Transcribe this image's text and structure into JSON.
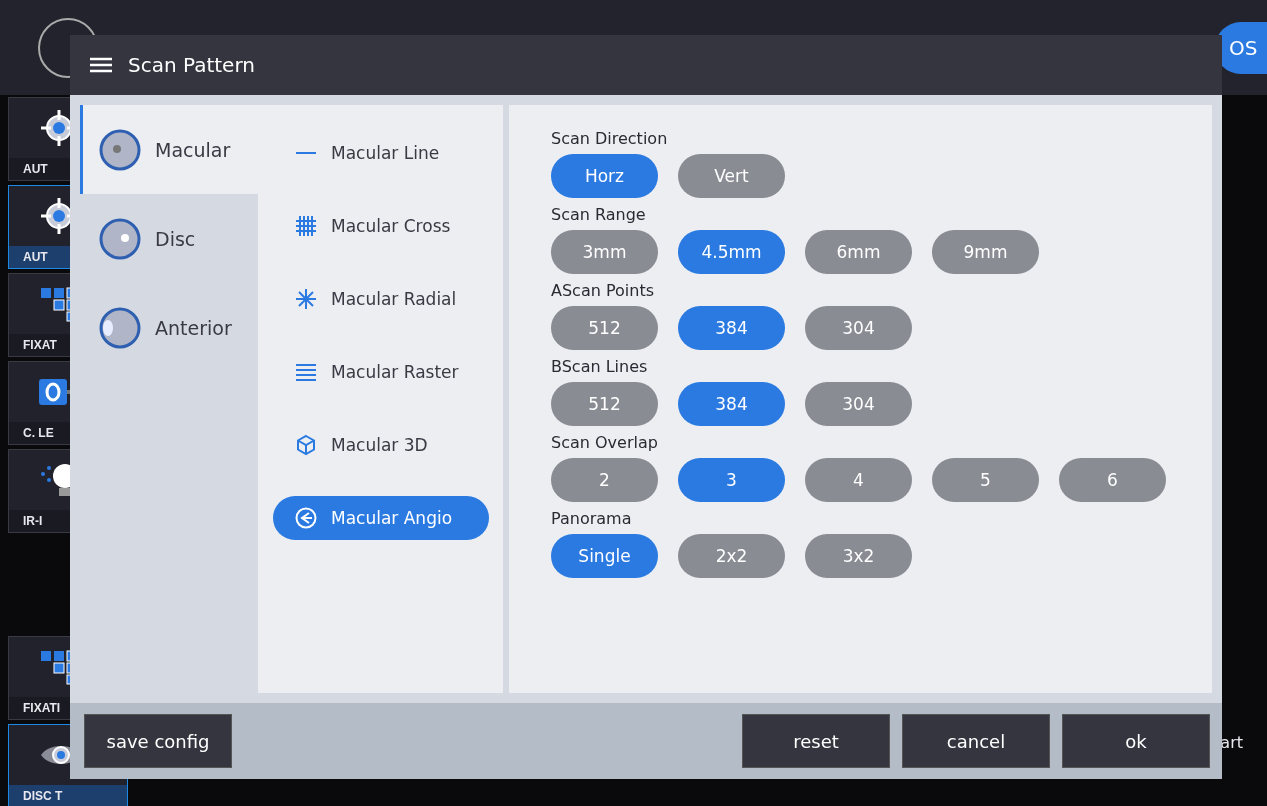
{
  "background": {
    "tiles": [
      {
        "label": "AUT",
        "kind": "target",
        "selected": false
      },
      {
        "label": "AUT",
        "kind": "target",
        "selected": true
      },
      {
        "label": "FIXAT",
        "kind": "grid",
        "selected": false
      },
      {
        "label": "C. LE",
        "kind": "lens",
        "selected": false
      },
      {
        "label": "IR-I",
        "kind": "bulb",
        "selected": false
      }
    ],
    "lower_tiles": [
      {
        "label": "FIXATI",
        "kind": "grid",
        "selected": false
      },
      {
        "label": "DISC T",
        "kind": "eye",
        "selected": true
      }
    ],
    "eye_badge": "OS",
    "side_label": "art"
  },
  "dialog": {
    "title": "Scan Pattern",
    "categories": [
      {
        "label": "Macular",
        "kind": "macular",
        "selected": true
      },
      {
        "label": "Disc",
        "kind": "disc",
        "selected": false
      },
      {
        "label": "Anterior",
        "kind": "anterior",
        "selected": false
      }
    ],
    "patterns": [
      {
        "label": "Macular Line",
        "kind": "line",
        "selected": false
      },
      {
        "label": "Macular Cross",
        "kind": "cross",
        "selected": false
      },
      {
        "label": "Macular Radial",
        "kind": "radial",
        "selected": false
      },
      {
        "label": "Macular Raster",
        "kind": "raster",
        "selected": false
      },
      {
        "label": "Macular 3D",
        "kind": "cube",
        "selected": false
      },
      {
        "label": "Macular Angio",
        "kind": "angio",
        "selected": true
      }
    ],
    "settings": [
      {
        "label": "Scan Direction",
        "options": [
          {
            "label": "Horz",
            "selected": true
          },
          {
            "label": "Vert",
            "selected": false
          }
        ]
      },
      {
        "label": "Scan Range",
        "options": [
          {
            "label": "3mm",
            "selected": false
          },
          {
            "label": "4.5mm",
            "selected": true
          },
          {
            "label": "6mm",
            "selected": false
          },
          {
            "label": "9mm",
            "selected": false
          }
        ]
      },
      {
        "label": "AScan Points",
        "options": [
          {
            "label": "512",
            "selected": false
          },
          {
            "label": "384",
            "selected": true
          },
          {
            "label": "304",
            "selected": false
          }
        ]
      },
      {
        "label": "BScan Lines",
        "options": [
          {
            "label": "512",
            "selected": false
          },
          {
            "label": "384",
            "selected": true
          },
          {
            "label": "304",
            "selected": false
          }
        ]
      },
      {
        "label": "Scan Overlap",
        "options": [
          {
            "label": "2",
            "selected": false
          },
          {
            "label": "3",
            "selected": true
          },
          {
            "label": "4",
            "selected": false
          },
          {
            "label": "5",
            "selected": false
          },
          {
            "label": "6",
            "selected": false
          }
        ]
      },
      {
        "label": "Panorama",
        "options": [
          {
            "label": "Single",
            "selected": true
          },
          {
            "label": "2x2",
            "selected": false
          },
          {
            "label": "3x2",
            "selected": false
          }
        ]
      }
    ],
    "footer_left": "save config",
    "footer_right": [
      "reset",
      "cancel",
      "ok"
    ]
  }
}
